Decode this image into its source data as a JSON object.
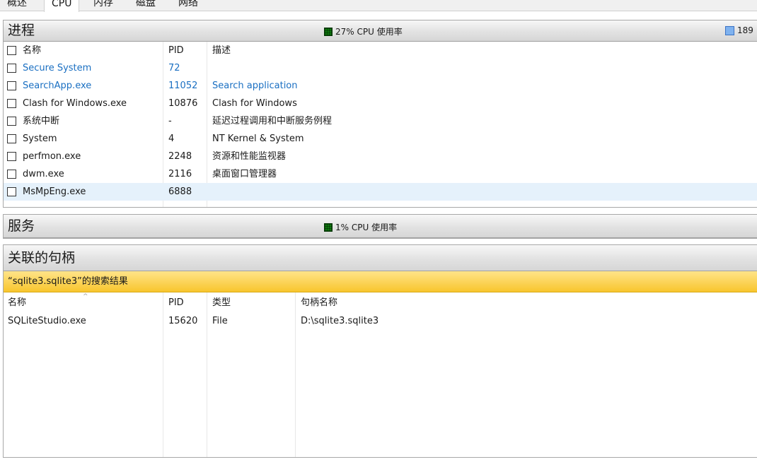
{
  "tabs": [
    "概述",
    "CPU",
    "内存",
    "磁盘",
    "网络"
  ],
  "processes": {
    "title": "进程",
    "cpu_usage": "27% CPU 使用率",
    "mem_usage": "189",
    "columns": {
      "name": "名称",
      "pid": "PID",
      "desc": "描述"
    },
    "rows": [
      {
        "name": "Secure System",
        "pid": "72",
        "desc": ""
      },
      {
        "name": "SearchApp.exe",
        "pid": "11052",
        "desc": "Search application"
      },
      {
        "name": "Clash for Windows.exe",
        "pid": "10876",
        "desc": "Clash for Windows"
      },
      {
        "name": "系统中断",
        "pid": "-",
        "desc": "延迟过程调用和中断服务例程"
      },
      {
        "name": "System",
        "pid": "4",
        "desc": "NT Kernel & System"
      },
      {
        "name": "perfmon.exe",
        "pid": "2248",
        "desc": "资源和性能监视器"
      },
      {
        "name": "dwm.exe",
        "pid": "2116",
        "desc": "桌面窗口管理器"
      },
      {
        "name": "MsMpEng.exe",
        "pid": "6888",
        "desc": ""
      }
    ]
  },
  "services": {
    "title": "服务",
    "cpu_usage": "1% CPU 使用率"
  },
  "handles": {
    "title": "关联的句柄",
    "search_label": "“sqlite3.sqlite3”的搜索结果",
    "columns": {
      "name": "名称",
      "pid": "PID",
      "type": "类型",
      "handle": "句柄名称"
    },
    "sort_indicator": "^",
    "rows": [
      {
        "name": "SQLiteStudio.exe",
        "pid": "15620",
        "type": "File",
        "handle": "D:\\sqlite3.sqlite3"
      }
    ]
  },
  "colors": {
    "accent_blue": "#1a6fc2",
    "search_highlight": "#f8c52d",
    "cpu_graph": "#0d7a0d",
    "mem_graph": "#7fb2ef",
    "selected_row": "#e5f1fb"
  }
}
